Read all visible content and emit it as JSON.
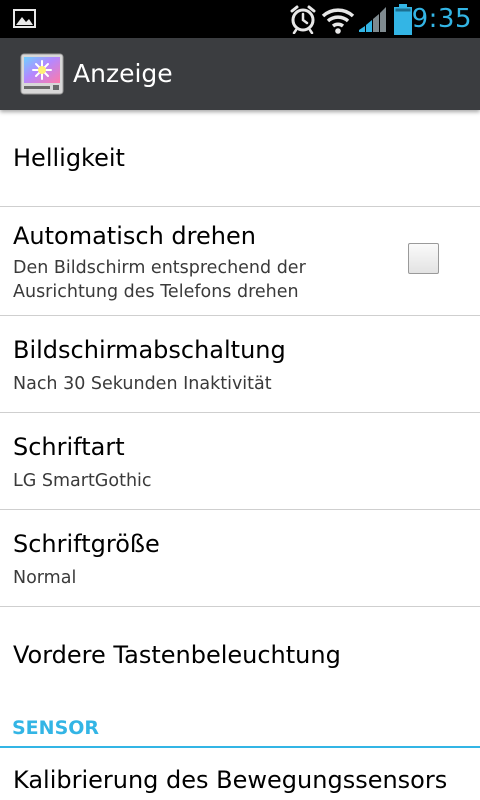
{
  "status_bar": {
    "time": "9:35",
    "icons": [
      "gallery-icon",
      "alarm-icon",
      "wifi-icon",
      "signal-icon",
      "battery-icon"
    ],
    "accent_color": "#33b5e5"
  },
  "action_bar": {
    "title": "Anzeige",
    "icon": "display-settings-icon"
  },
  "settings": {
    "brightness": {
      "title": "Helligkeit"
    },
    "auto_rotate": {
      "title": "Automatisch drehen",
      "summary_line1": "Den Bildschirm entsprechend der",
      "summary_line2": "Ausrichtung des Telefons drehen",
      "checked": false
    },
    "screen_timeout": {
      "title": "Bildschirmabschaltung",
      "summary": "Nach 30 Sekunden Inaktivität"
    },
    "font_type": {
      "title": "Schriftart",
      "summary": "LG SmartGothic"
    },
    "font_size": {
      "title": "Schriftgröße",
      "summary": "Normal"
    },
    "front_key_light": {
      "title": "Vordere Tastenbeleuchtung"
    }
  },
  "sensor_section": {
    "header": "SENSOR",
    "motion_calibration": {
      "title": "Kalibrierung des Bewegungssensors"
    }
  }
}
